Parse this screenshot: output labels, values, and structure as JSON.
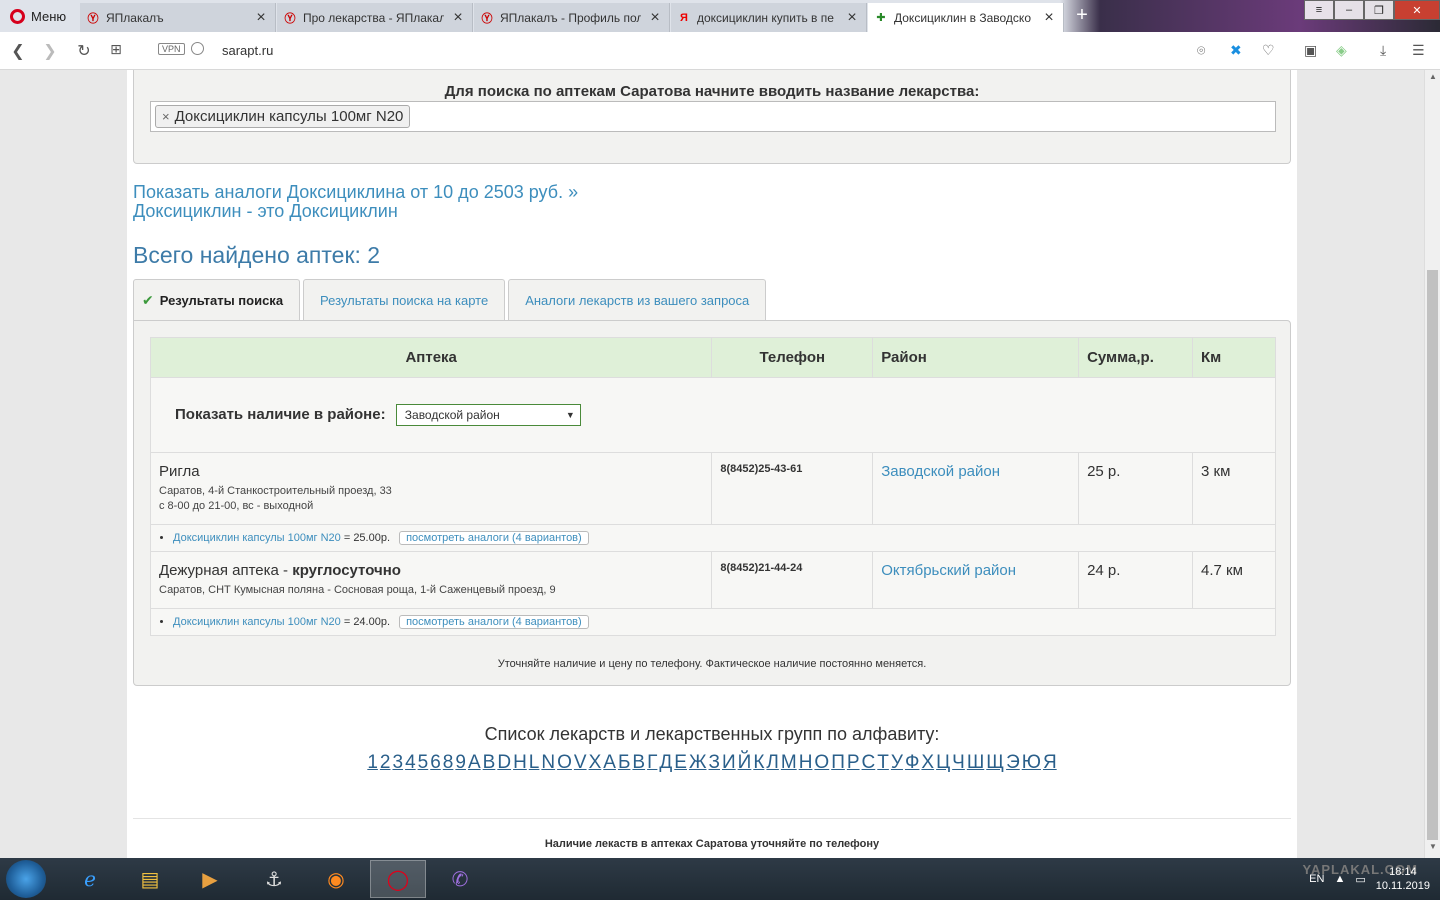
{
  "browser": {
    "menu_label": "Меню",
    "tabs": [
      {
        "title": "ЯПлакалъ",
        "fav": "Ⓨ"
      },
      {
        "title": "Про лекарства - ЯПлакалъ",
        "fav": "Ⓨ"
      },
      {
        "title": "ЯПлакалъ - Профиль поль",
        "fav": "Ⓨ"
      },
      {
        "title": "доксициклин купить в пе",
        "fav": "Я"
      },
      {
        "title": "Доксициклин в Заводско",
        "fav": "✚"
      }
    ],
    "url": "sarapt.ru",
    "vpn_label": "VPN"
  },
  "search": {
    "label": "Для поиска по аптекам Саратова начните вводить название лекарства:",
    "chip": "Доксициклин капсулы 100мг N20",
    "chip_remove": "×"
  },
  "links": {
    "analogs": "Показать аналоги Доксициклина от 10 до 2503 руб. »",
    "same": "Доксициклин - это Доксициклин"
  },
  "found_text": "Всего найдено аптек: 2",
  "tabs": [
    {
      "label": "Результаты поиска"
    },
    {
      "label": "Результаты поиска на карте"
    },
    {
      "label": "Аналоги лекарств из вашего запроса"
    }
  ],
  "table": {
    "headers": [
      "Аптека",
      "Телефон",
      "Район",
      "Сумма,р.",
      "Км"
    ],
    "filter_label": "Показать наличие в районе:",
    "filter_value": "Заводской район",
    "rows": [
      {
        "name": "Ригла",
        "name_extra": "",
        "address": "Саратов, 4-й Станкостроительный проезд, 33",
        "hours": "с 8-00 до 21-00, вс - выходной",
        "phone": "8(8452)25-43-61",
        "district": "Заводской район",
        "sum": "25 р.",
        "km": "3 км",
        "drug": "Доксициклин капсулы 100мг N20",
        "drug_price": " = 25.00р.",
        "analogs": "посмотреть аналоги (4 вариантов)"
      },
      {
        "name": "Дежурная аптека - ",
        "name_extra": "круглосуточно",
        "address": "Саратов, СНТ Кумысная поляна - Сосновая роща, 1-й Саженцевый проезд, 9",
        "hours": "",
        "phone": "8(8452)21-44-24",
        "district": "Октябрьский район",
        "sum": "24 р.",
        "km": "4.7 км",
        "drug": "Доксициклин капсулы 100мг N20",
        "drug_price": " = 24.00р.",
        "analogs": "посмотреть аналоги (4 вариантов)"
      }
    ],
    "note": "Уточняйте наличие и цену по телефону. Фактическое наличие постоянно меняется."
  },
  "alphabet": {
    "title": "Список лекарств и лекарственных групп по алфавиту:",
    "letters": [
      "1",
      "2",
      "3",
      "4",
      "5",
      "6",
      "8",
      "9",
      "A",
      "B",
      "D",
      "H",
      "L",
      "N",
      "O",
      "V",
      "X",
      "А",
      "Б",
      "В",
      "Г",
      "Д",
      "Е",
      "Ж",
      "З",
      "И",
      "Й",
      "К",
      "Л",
      "М",
      "Н",
      "О",
      "П",
      "Р",
      "С",
      "Т",
      "У",
      "Ф",
      "Х",
      "Ц",
      "Ч",
      "Ш",
      "Щ",
      "Э",
      "Ю",
      "Я"
    ]
  },
  "footer": "Наличие лекаств в аптеках Саратова уточняйте по телефону",
  "taskbar": {
    "lang": "EN",
    "time": "18:14",
    "date": "10.11.2019",
    "watermark": "YAPLAKAL.COM"
  },
  "colors": {
    "link": "#3d8ebd",
    "header_green": "#dff0d8",
    "opera_red": "#d6001c"
  }
}
